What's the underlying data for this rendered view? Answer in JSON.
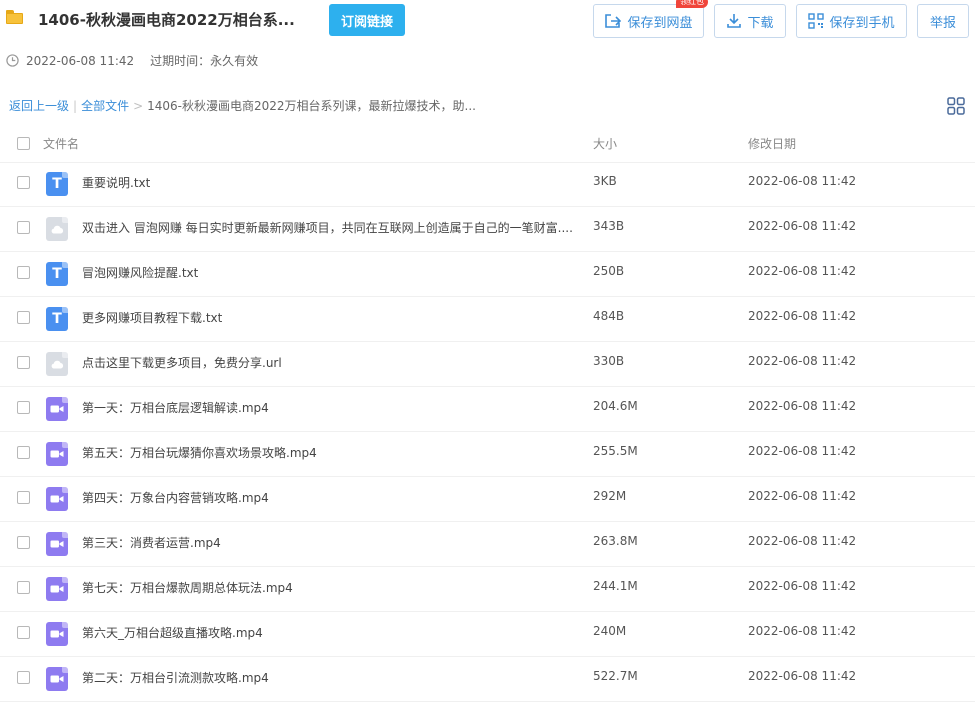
{
  "share": {
    "title": "1406-秋秋漫画电商2022万相台系...",
    "date": "2022-06-08 11:42",
    "expire_label": "过期时间：永久有效"
  },
  "actions": {
    "subscribe": "订阅链接",
    "save_to_cloud": "保存到网盘",
    "download": "下载",
    "save_to_phone": "保存到手机",
    "report": "举报",
    "badge": "领红包"
  },
  "breadcrumb": {
    "back": "返回上一级",
    "all_files": "全部文件",
    "separator": ">",
    "current": "1406-秋秋漫画电商2022万相台系列课，最新拉爆技术，助..."
  },
  "table": {
    "headers": {
      "name": "文件名",
      "size": "大小",
      "date": "修改日期"
    },
    "rows": [
      {
        "icon": "txt",
        "name": "重要说明.txt",
        "size": "3KB",
        "date": "2022-06-08 11:42"
      },
      {
        "icon": "url",
        "name": "双击进入 冒泡网赚 每日实时更新最新网赚项目，共同在互联网上创造属于自己的一笔财富....",
        "size": "343B",
        "date": "2022-06-08 11:42"
      },
      {
        "icon": "txt",
        "name": "冒泡网赚风险提醒.txt",
        "size": "250B",
        "date": "2022-06-08 11:42"
      },
      {
        "icon": "txt",
        "name": "更多网赚项目教程下载.txt",
        "size": "484B",
        "date": "2022-06-08 11:42"
      },
      {
        "icon": "url",
        "name": "点击这里下载更多项目，免费分享.url",
        "size": "330B",
        "date": "2022-06-08 11:42"
      },
      {
        "icon": "mp4",
        "name": "第一天：万相台底层逻辑解读.mp4",
        "size": "204.6M",
        "date": "2022-06-08 11:42"
      },
      {
        "icon": "mp4",
        "name": "第五天：万相台玩爆猜你喜欢场景攻略.mp4",
        "size": "255.5M",
        "date": "2022-06-08 11:42"
      },
      {
        "icon": "mp4",
        "name": "第四天：万象台内容营销攻略.mp4",
        "size": "292M",
        "date": "2022-06-08 11:42"
      },
      {
        "icon": "mp4",
        "name": "第三天：消费者运营.mp4",
        "size": "263.8M",
        "date": "2022-06-08 11:42"
      },
      {
        "icon": "mp4",
        "name": "第七天：万相台爆款周期总体玩法.mp4",
        "size": "244.1M",
        "date": "2022-06-08 11:42"
      },
      {
        "icon": "mp4",
        "name": "第六天_万相台超级直播攻略.mp4",
        "size": "240M",
        "date": "2022-06-08 11:42"
      },
      {
        "icon": "mp4",
        "name": "第二天：万相台引流测款攻略.mp4",
        "size": "522.7M",
        "date": "2022-06-08 11:42"
      }
    ]
  },
  "colors": {
    "accent": "#2db0ee",
    "link": "#3b8ed8",
    "txt_icon": "#4a90f0",
    "url_icon": "#d9dde3",
    "video_icon": "#8e7bf0",
    "badge": "#f0453a"
  }
}
